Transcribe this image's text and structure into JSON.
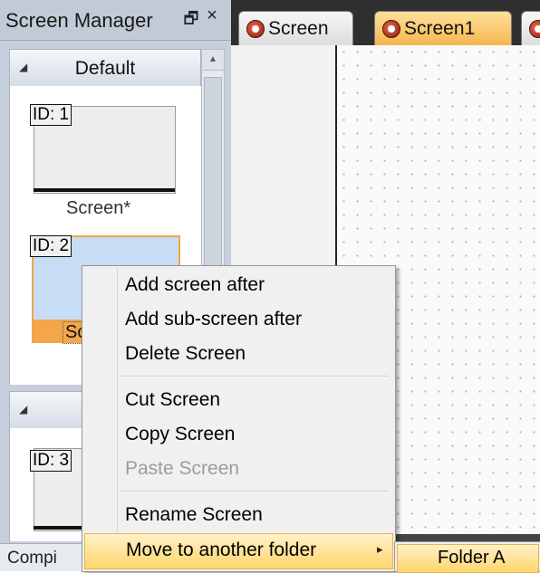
{
  "screen_manager": {
    "title": "Screen Manager",
    "float_glyph": "🗗",
    "close_glyph": "×",
    "groups": [
      {
        "label": "Default",
        "arrow": "◢"
      },
      {
        "label": "",
        "arrow": "◢"
      }
    ],
    "screens": [
      {
        "id_label": "ID: 1",
        "caption": "Screen*"
      },
      {
        "id_label": "ID: 2",
        "caption": "Sc"
      },
      {
        "id_label": "ID: 3",
        "caption": ""
      }
    ],
    "scroll_up": "▲"
  },
  "tabs": [
    {
      "label": "Screen"
    },
    {
      "label": "Screen1"
    }
  ],
  "bottom_tab": {
    "label": "Compi"
  },
  "context_menu": {
    "items": [
      {
        "label": "Add screen after",
        "enabled": true
      },
      {
        "label": "Add sub-screen after",
        "enabled": true
      },
      {
        "label": "Delete Screen",
        "enabled": true
      },
      {
        "label": "Cut Screen",
        "enabled": true
      },
      {
        "label": "Copy Screen",
        "enabled": true
      },
      {
        "label": "Paste Screen",
        "enabled": false
      },
      {
        "label": "Rename Screen",
        "enabled": true
      },
      {
        "label": "Move to another folder",
        "enabled": true,
        "submenu_arrow": "▸"
      }
    ],
    "submenu": {
      "items": [
        {
          "label": "Folder A"
        }
      ]
    }
  },
  "colors": {
    "selection_highlight": "#f3a64a",
    "selected_thumb": "#c6ddf5",
    "menu_hover": "#ffd56b"
  }
}
